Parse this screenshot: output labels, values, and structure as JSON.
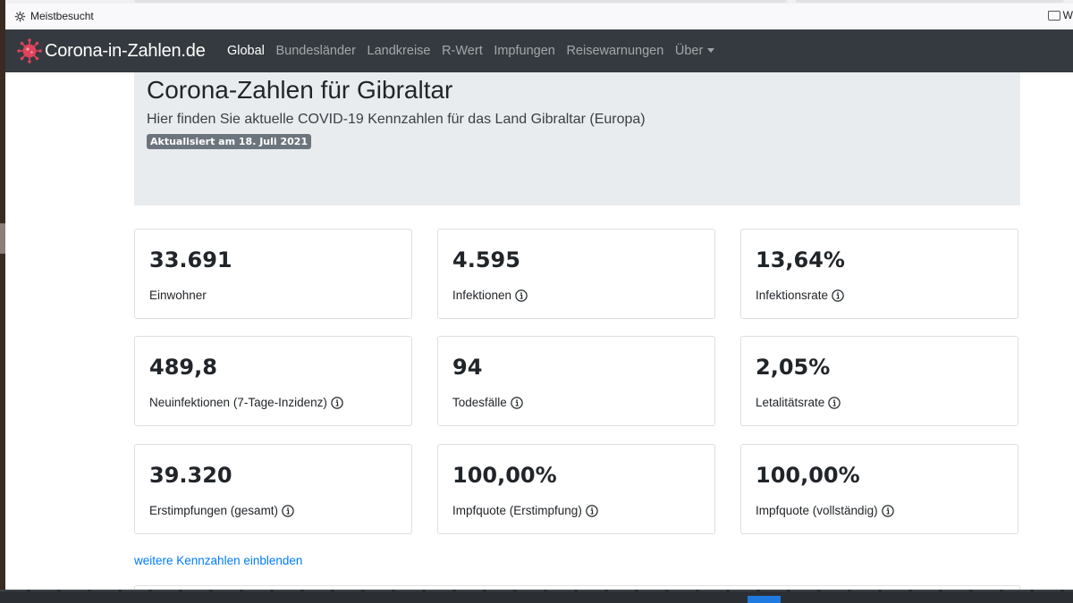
{
  "browser": {
    "bookmark_label": "Meistbesucht",
    "folder_label": "W"
  },
  "navbar": {
    "brand": "Corona-in-Zahlen.de",
    "links": [
      {
        "label": "Global",
        "active": true
      },
      {
        "label": "Bundesländer",
        "active": false
      },
      {
        "label": "Landkreise",
        "active": false
      },
      {
        "label": "R-Wert",
        "active": false
      },
      {
        "label": "Impfungen",
        "active": false
      },
      {
        "label": "Reisewarnungen",
        "active": false
      },
      {
        "label": "Über",
        "active": false
      }
    ]
  },
  "header": {
    "title": "Corona-Zahlen für Gibraltar",
    "subtitle": "Hier finden Sie aktuelle COVID-19 Kennzahlen für das Land Gibraltar (Europa)",
    "badge": "Aktualisiert am 18. Juli 2021"
  },
  "stats": [
    {
      "value": "33.691",
      "label": "Einwohner"
    },
    {
      "value": "4.595",
      "label": "Infektionen"
    },
    {
      "value": "13,64%",
      "label": "Infektionsrate"
    },
    {
      "value": "489,8",
      "label": "Neuinfektionen (7-Tage-Inzidenz)"
    },
    {
      "value": "94",
      "label": "Todesfälle"
    },
    {
      "value": "2,05%",
      "label": "Letalitätsrate"
    },
    {
      "value": "39.320",
      "label": "Erstimpfungen (gesamt)"
    },
    {
      "value": "100,00%",
      "label": "Impfquote (Erstimpfung)"
    },
    {
      "value": "100,00%",
      "label": "Impfquote (vollständig)"
    }
  ],
  "more_link": "weitere Kennzahlen einblenden",
  "colors": {
    "navbar_bg": "#343a40",
    "jumbotron_bg": "#e9ecef",
    "badge_bg": "#6c757d",
    "link": "#007bff",
    "logo": "#e0435a"
  }
}
